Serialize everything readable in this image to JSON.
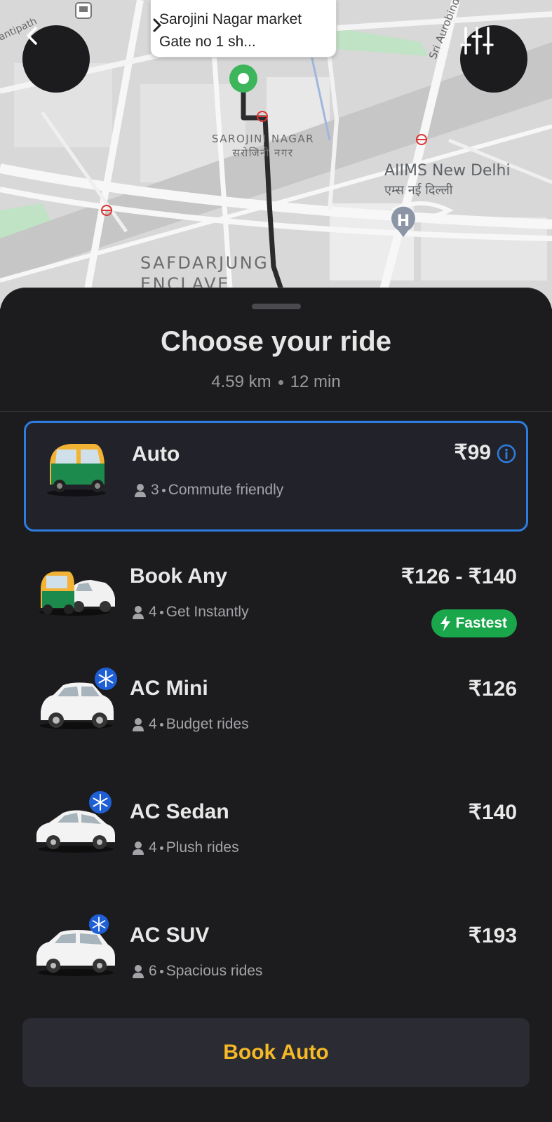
{
  "map": {
    "pickup_label": "Sarojini Nagar market Gate no 1 sh...",
    "labels": {
      "sarojini_en": "SAROJINI NAGAR",
      "sarojini_hi": "सरोजिनी नगर",
      "aiims_en": "AIIMS New Delhi",
      "aiims_hi": "एम्स नई दिल्ली",
      "safdarjung": "SAFDARJUNG",
      "safdarjung_2": "ENCLAVE",
      "road": "Sri Aurobindo Ma",
      "antipath": "antipath"
    },
    "icons": {
      "back": "back-arrow-icon",
      "filter": "sliders-icon",
      "pickup": "pickup-pin-icon",
      "hospital": "hospital-icon",
      "metro": "metro-icon",
      "bus": "bus-stop-icon"
    }
  },
  "sheet": {
    "title": "Choose your ride",
    "distance": "4.59 km",
    "duration": "12 min"
  },
  "rides": [
    {
      "name": "Auto",
      "seats": "3",
      "desc": "Commute friendly",
      "price": "₹99",
      "selected": true
    },
    {
      "name": "Book Any",
      "seats": "4",
      "desc": "Get Instantly",
      "price": "₹126 - ₹140",
      "badge": "Fastest"
    },
    {
      "name": "AC Mini",
      "seats": "4",
      "desc": "Budget rides",
      "price": "₹126"
    },
    {
      "name": "AC Sedan",
      "seats": "4",
      "desc": "Plush rides",
      "price": "₹140"
    },
    {
      "name": "AC SUV",
      "seats": "6",
      "desc": "Spacious rides",
      "price": "₹193"
    }
  ],
  "book_button": "Book Auto",
  "colors": {
    "accent_selected": "#2d7de0",
    "fastest_badge": "#1aa64a",
    "book_text": "#f5b826",
    "ac_badge": "#1f5fd6"
  }
}
